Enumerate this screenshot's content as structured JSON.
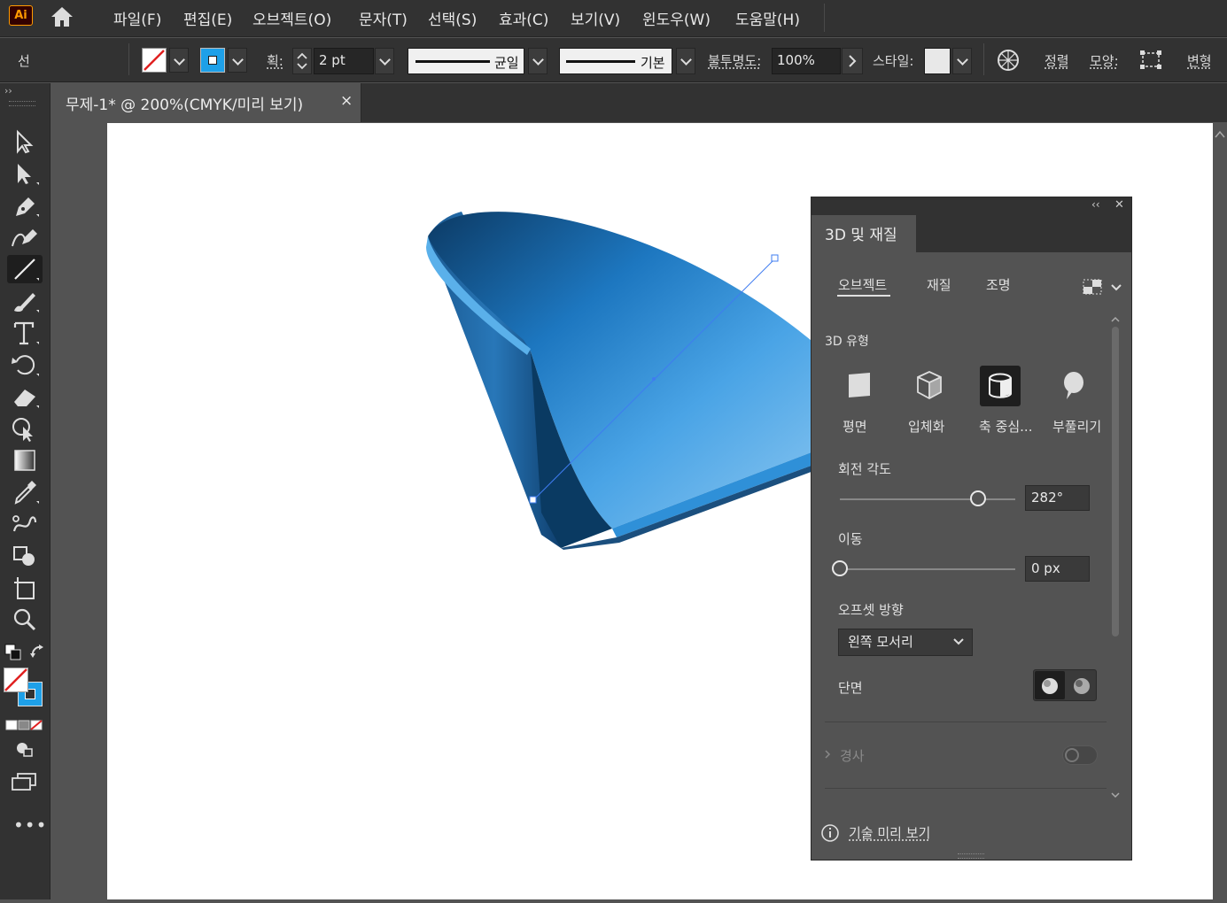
{
  "app": {
    "logo": "Ai"
  },
  "menu": [
    "파일(F)",
    "편집(E)",
    "오브젝트(O)",
    "문자(T)",
    "선택(S)",
    "효과(C)",
    "보기(V)",
    "윈도우(W)",
    "도움말(H)"
  ],
  "control_bar": {
    "selection_label": "선",
    "stroke_weight_label": "획:",
    "stroke_weight_value": "2 pt",
    "profile_label": "균일",
    "brush_label": "기본",
    "opacity_label": "불투명도:",
    "opacity_value": "100%",
    "style_label": "스타일:",
    "align_label": "정렬",
    "shape_label": "모양:",
    "transform_label": "변형"
  },
  "document_tab": {
    "title": "무제-1* @ 200%(CMYK/미리 보기)",
    "close": "×"
  },
  "panel": {
    "title": "3D 및 재질",
    "tabs": [
      "오브젝트",
      "재질",
      "조명"
    ],
    "section_3d_type": "3D 유형",
    "types": [
      {
        "label": "평면",
        "icon": "plane-icon"
      },
      {
        "label": "입체화",
        "icon": "extrude-icon"
      },
      {
        "label": "축 중심...",
        "icon": "revolve-icon",
        "active": true
      },
      {
        "label": "부풀리기",
        "icon": "inflate-icon"
      }
    ],
    "rotation_label": "회전 각도",
    "rotation_value": "282°",
    "rotation_fraction": 0.79,
    "move_label": "이동",
    "move_value": "0 px",
    "move_fraction": 0.0,
    "offset_label": "오프셋 방향",
    "offset_value": "왼쪽 모서리",
    "cap_label": "단면",
    "bevel_label": "경사",
    "bevel_on": false,
    "preview_label": "기술 미리 보기",
    "collapse": "‹‹",
    "close": "✕"
  },
  "colors": {
    "accent": "#1473e6",
    "object_blue": "#2b8fd6"
  }
}
